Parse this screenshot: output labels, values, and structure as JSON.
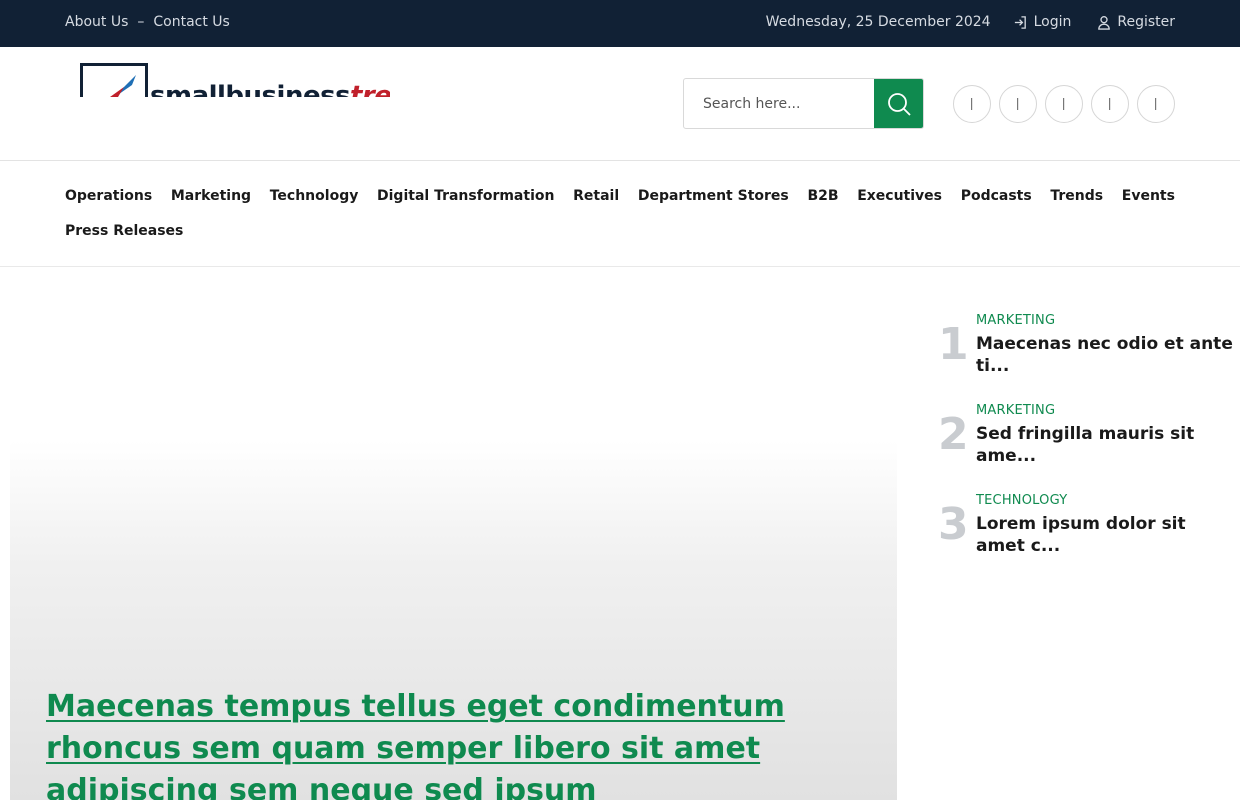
{
  "topbar": {
    "links": [
      "About Us",
      "Contact Us"
    ],
    "separator": "–",
    "date": "Wednesday, 25 December 2024",
    "login": "Login",
    "register": "Register"
  },
  "header": {
    "logo": {
      "part1": "smallbusiness",
      "part2": "trends"
    },
    "search": {
      "placeholder": "Search here..."
    },
    "social_icons": [
      "facebook-icon",
      "twitter-icon",
      "linkedin-icon",
      "youtube-icon",
      "instagram-icon"
    ]
  },
  "nav": {
    "items": [
      "Operations",
      "Marketing",
      "Technology",
      "Digital Transformation",
      "Retail",
      "Department Stores",
      "B2B",
      "Executives",
      "Podcasts",
      "Trends",
      "Events",
      "Press Releases"
    ]
  },
  "hero": {
    "title": "Maecenas tempus tellus eget condimentum rhoncus sem quam semper libero sit amet adipiscing sem neque sed ipsum"
  },
  "trending": [
    {
      "num": "1",
      "category": "MARKETING",
      "title": "Maecenas nec odio et ante ti..."
    },
    {
      "num": "2",
      "category": "MARKETING",
      "title": "Sed fringilla mauris sit ame..."
    },
    {
      "num": "3",
      "category": "TECHNOLOGY",
      "title": "Lorem ipsum dolor sit amet c..."
    }
  ],
  "colors": {
    "topbar": "#112135",
    "accent": "#0f8a4f",
    "logo_red": "#c0202b"
  }
}
